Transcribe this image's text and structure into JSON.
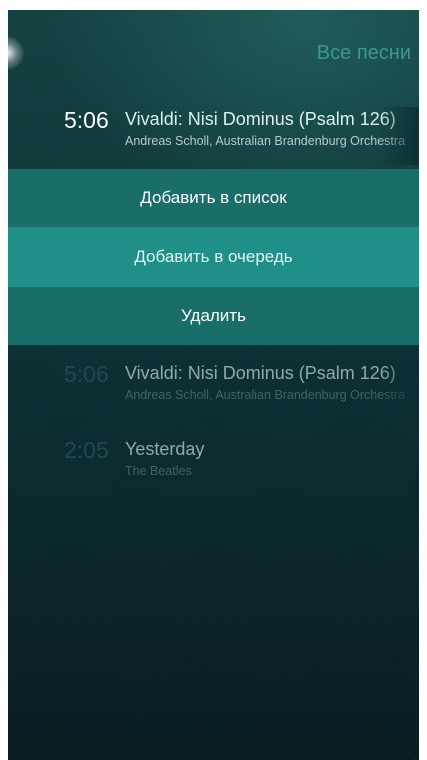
{
  "header": {
    "title": "Все песни"
  },
  "selected_track": {
    "duration": "5:06",
    "title": "Vivaldi: Nisi Dominus (Psalm 126)",
    "artist": "Andreas Scholl, Australian Brandenburg Orchestra"
  },
  "context_menu": {
    "items": [
      {
        "label": "Добавить в список"
      },
      {
        "label": "Добавить в очередь"
      },
      {
        "label": "Удалить"
      }
    ]
  },
  "tracks": [
    {
      "duration": "5:06",
      "title": "Vivaldi: Nisi Dominus (Psalm 126)",
      "artist": "Andreas Scholl, Australian Brandenburg Orchestra"
    },
    {
      "duration": "2:05",
      "title": "Yesterday",
      "artist": "The Beatles"
    }
  ],
  "colors": {
    "menu_item": "#196e6a",
    "menu_item_highlight": "#208f88",
    "header_accent": "#3c9890"
  }
}
